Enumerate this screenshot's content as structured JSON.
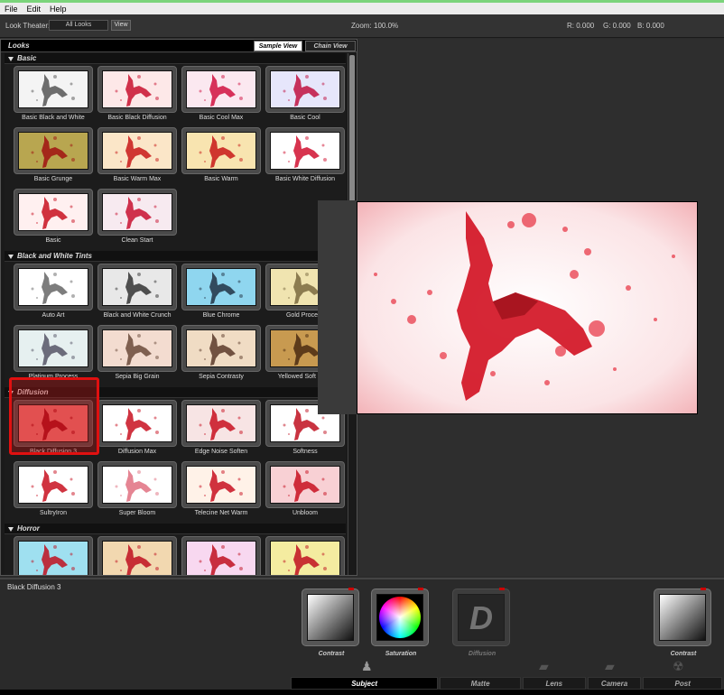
{
  "menu": [
    "File",
    "Edit",
    "Help"
  ],
  "toolbar": {
    "look_theater_label": "Look Theater:",
    "theater_value": "All Looks",
    "view_label": "View",
    "zoom_label": "Zoom:",
    "zoom_value": "100.0%",
    "r": "R: 0.000",
    "g": "G: 0.000",
    "b": "B: 0.000"
  },
  "looks": {
    "title": "Looks",
    "tab_sample": "Sample View",
    "tab_chain": "Chain View",
    "categories": [
      {
        "name": "Basic",
        "items": [
          "Basic Black and White",
          "Basic Black Diffusion",
          "Basic Cool Max",
          "Basic Cool",
          "Basic Grunge",
          "Basic Warm Max",
          "Basic Warm",
          "Basic White Diffusion",
          "Basic",
          "Clean Start"
        ]
      },
      {
        "name": "Black and White Tints",
        "items": [
          "Auto Art",
          "Black and White Crunch",
          "Blue Chrome",
          "Gold Process",
          "Platinum Process",
          "Sepia Big Grain",
          "Sepia Contrasty",
          "Yellowed Soft Edge"
        ]
      },
      {
        "name": "Diffusion",
        "items": [
          "Black Diffusion 3",
          "Diffusion Max",
          "Edge Noise Soften",
          "Softness",
          "SultryIron",
          "Super Bloom",
          "Telecine Net Warm",
          "Unbloom"
        ]
      },
      {
        "name": "Horror",
        "items": []
      }
    ]
  },
  "bottom": {
    "selected_look": "Black Diffusion 3",
    "tools": [
      "Contrast",
      "Saturation",
      "Diffusion",
      "Contrast"
    ],
    "tabs": [
      "Subject",
      "Matte",
      "Lens",
      "Camera",
      "Post"
    ]
  },
  "colors": {
    "accent_red": "#e01010",
    "panel_bg": "#1a1a1a"
  }
}
